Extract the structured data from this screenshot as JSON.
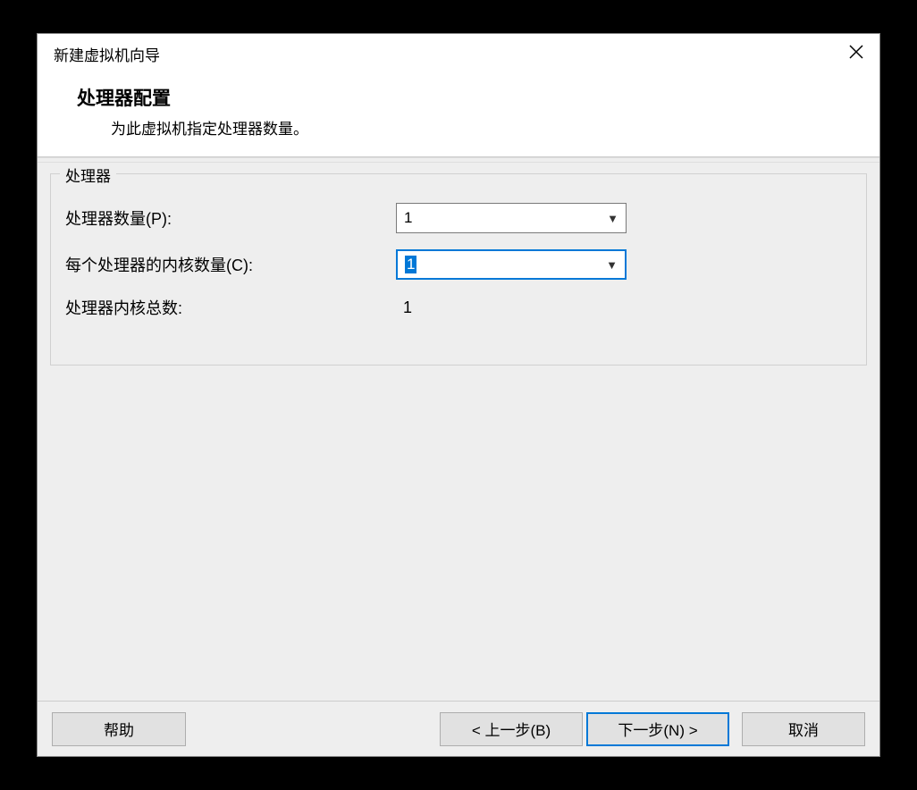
{
  "titlebar": {
    "title": "新建虚拟机向导"
  },
  "header": {
    "title": "处理器配置",
    "subtitle": "为此虚拟机指定处理器数量。"
  },
  "group": {
    "legend": "处理器",
    "rows": {
      "processors": {
        "label": "处理器数量(P):",
        "value": "1"
      },
      "cores": {
        "label": "每个处理器的内核数量(C):",
        "value": "1"
      },
      "total": {
        "label": "处理器内核总数:",
        "value": "1"
      }
    }
  },
  "footer": {
    "help": "帮助",
    "back": "< 上一步(B)",
    "next": "下一步(N) >",
    "cancel": "取消"
  }
}
